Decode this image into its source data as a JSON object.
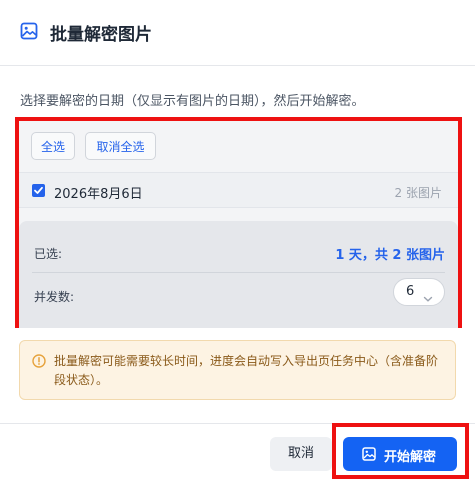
{
  "dialog": {
    "title": "批量解密图片",
    "icon": "image-icon"
  },
  "hint": "选择要解密的日期（仅显示有图片的日期），然后开始解密。",
  "buttons": {
    "select_all": "全选",
    "deselect_all": "取消全选"
  },
  "dates": [
    {
      "label": "2026年8月6日",
      "count": "2 张图片",
      "checked": true
    }
  ],
  "summary": {
    "selected_label": "已选:",
    "selected_value": "1 天，共 2 张图片",
    "concurrency_label": "并发数:",
    "concurrency_value": "6"
  },
  "warning": {
    "icon": "alert-circle-icon",
    "text": "批量解密可能需要较长时间，进度会自动写入导出页任务中心（含准备阶段状态）。"
  },
  "footer": {
    "cancel": "取消",
    "start": "开始解密",
    "start_icon": "image-icon"
  },
  "colors": {
    "accent": "#2563eb",
    "primary_button": "#1463f3",
    "highlight_frame": "#ee1111",
    "warning_bg": "#fdf3e3",
    "warning_text": "#8a5a1a"
  }
}
